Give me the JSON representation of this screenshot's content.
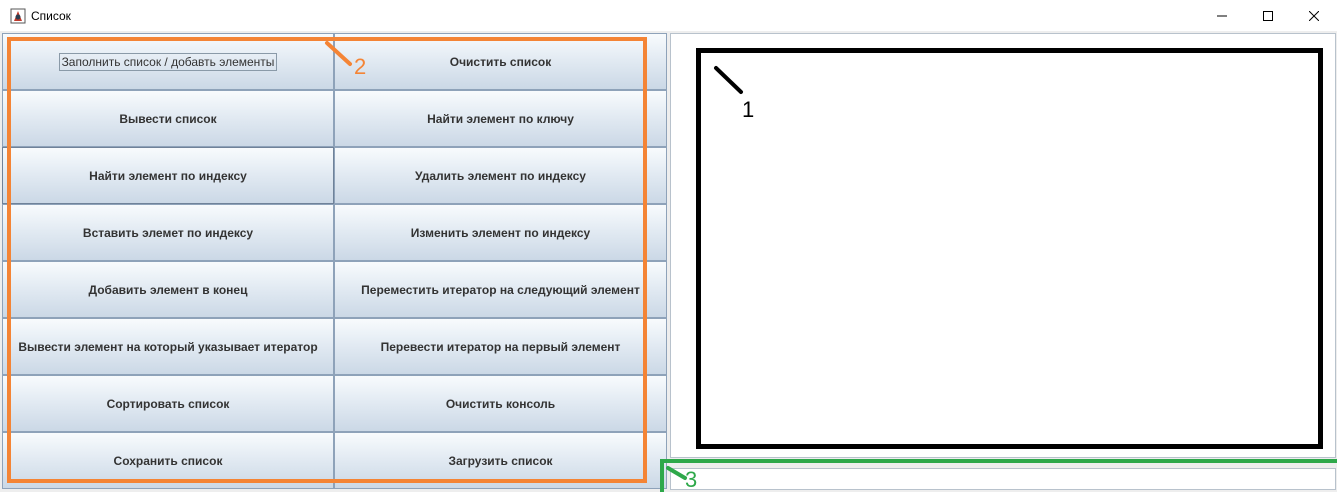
{
  "window": {
    "title": "Список",
    "icons": {
      "app": "java-app-icon",
      "minimize": "minimize-icon",
      "maximize": "maximize-icon",
      "close": "close-icon"
    }
  },
  "buttons": [
    {
      "label": "Заполнить список / добавть элементы",
      "focused": true
    },
    {
      "label": "Очистить список"
    },
    {
      "label": "Вывести список"
    },
    {
      "label": "Найти элемент по ключу"
    },
    {
      "label": "Найти элемент по индексу",
      "pressed": true
    },
    {
      "label": "Удалить элемент по индексу"
    },
    {
      "label": "Вставить элемет по индексу"
    },
    {
      "label": "Изменить элемент по индексу"
    },
    {
      "label": "Добавить элемент в конец"
    },
    {
      "label": "Переместить итератор на следующий элемент"
    },
    {
      "label": "Вывести элемент на который указывает итератор"
    },
    {
      "label": "Перевести итератор на первый элемент"
    },
    {
      "label": "Сортировать список"
    },
    {
      "label": "Очистить консоль"
    },
    {
      "label": "Сохранить список"
    },
    {
      "label": "Загрузить список"
    }
  ],
  "output_area": {
    "value": ""
  },
  "console_input": {
    "value": ""
  },
  "annotations": {
    "output_label": "1",
    "buttons_label": "2",
    "input_label": "3",
    "colors": {
      "output": "#000000",
      "buttons": "#f48435",
      "input": "#2ea84a"
    }
  }
}
